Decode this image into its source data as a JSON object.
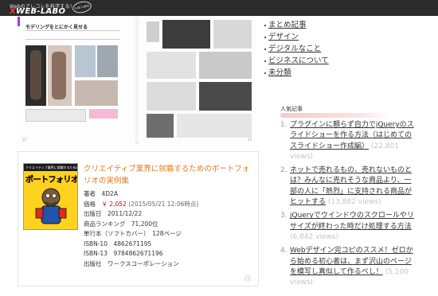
{
  "header": {
    "tagline": "Webのアレコレを科学する！",
    "logo_prefix": "X",
    "logo_text": "WEB-LABO",
    "badge": "Lab Labo"
  },
  "spread": {
    "title": "モデリングをとにかく見せる",
    "page_left": "22",
    "page_right": "23"
  },
  "sidebar": {
    "categories": [
      {
        "label": "まとめ記事"
      },
      {
        "label": "デザイン"
      },
      {
        "label": "デジタルなこと"
      },
      {
        "label": "ビジネスについて"
      },
      {
        "label": "未分類"
      }
    ],
    "popular_heading": "人気記事",
    "popular": [
      {
        "num": "1.",
        "title": "プラグインに頼らず自力でjQueryのスライドショーを作る方法（はじめてのスライドショー作成編）",
        "views": "(22,801 views)"
      },
      {
        "num": "2.",
        "title": "ネットで売れるもの、売れないものとは？みんなに売れそうな商品より、一部の人に「熱烈」に支持される商品がヒットする",
        "views": "(13,882 views)"
      },
      {
        "num": "3.",
        "title": "jQueryでウインドウのスクロールやリサイズが終わった時だけ処理する方法",
        "views": "(6,842 views)"
      },
      {
        "num": "4.",
        "title": "Webデザイン完コピのススメ！ゼロから始める初心者は、まず沢山のページを模写し真似して作るべし！",
        "views": "(5,100 views)"
      }
    ]
  },
  "product": {
    "title": "クリエイティブ業界に就職するためのポートフォリオの実例集",
    "cover_top": "クリエイティブ業界に就職するための",
    "cover_title": "ポートフォリオ実例集",
    "author_label": "著者",
    "author": "4D2A",
    "price_label": "価格",
    "price": "￥ 2,052",
    "price_stamp": "(2015/05/21 12:06時点)",
    "release_label": "出版日",
    "release": "2011/12/22",
    "ranking_label": "商品ランキング",
    "ranking": "71,200位",
    "binding": "単行本（ソフトカバー）",
    "pages": "128ページ",
    "isbn10_label": "ISBN-10",
    "isbn10": "4862671195",
    "isbn13_label": "ISBN-13",
    "isbn13": "9784862671196",
    "publisher_label": "出版社",
    "publisher": "ワークスコーポレーション",
    "amazon_mark": "a"
  },
  "colors": {
    "topbar": "#2b2b2b",
    "product_title": "#e8781e",
    "price": "#d0021b",
    "views": "#c4c4c4",
    "popular_underline": "#f8c9c9"
  }
}
